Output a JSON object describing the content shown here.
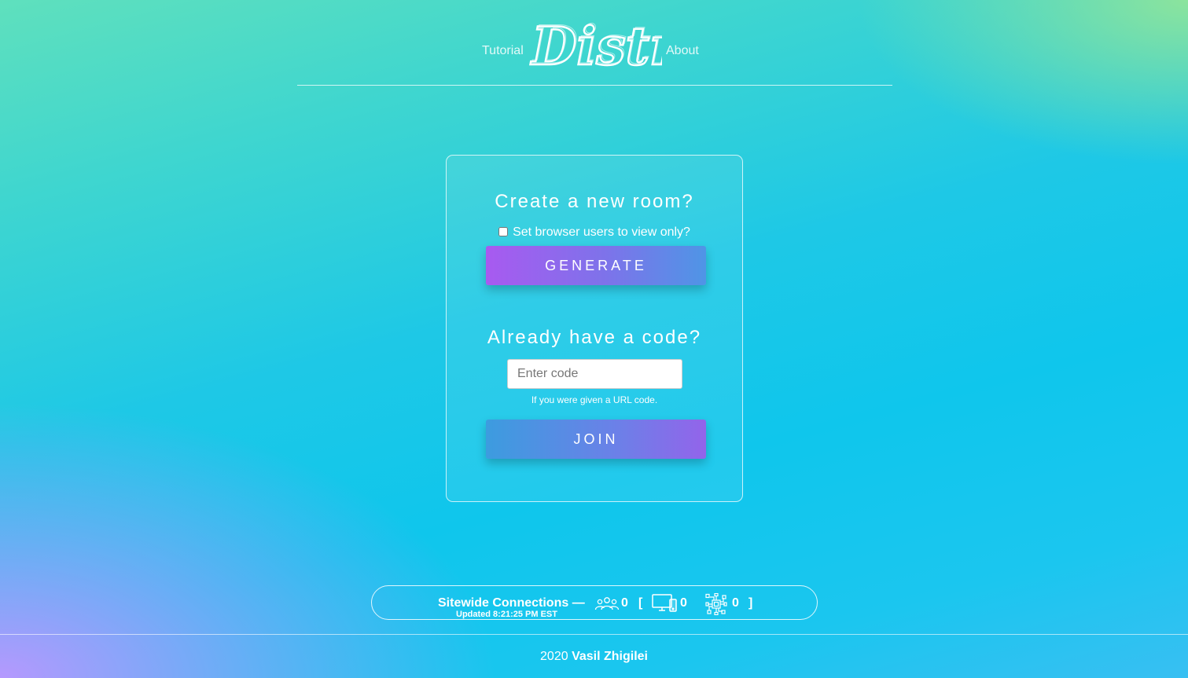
{
  "nav": {
    "tutorial": "Tutorial",
    "logo_text": "Distri",
    "about": "About"
  },
  "create": {
    "heading": "Create a new room?",
    "checkbox_label": "Set browser users to view only?",
    "checkbox_checked": false,
    "generate_label": "GENERATE"
  },
  "join": {
    "heading": "Already have a code?",
    "placeholder": "Enter code",
    "value": "",
    "hint": "If you were given a URL code.",
    "join_label": "JOIN"
  },
  "stats": {
    "title": "Sitewide Connections —",
    "updated": "Updated 8:21:25 PM EST",
    "users": "0",
    "bracket_open": "[",
    "devices": "0",
    "networks": "0",
    "bracket_close": "]",
    "icons": [
      "users-icon",
      "devices-icon",
      "network-icon"
    ]
  },
  "footer": {
    "year": "2020",
    "author": "Vasil Zhigilei"
  },
  "colors": {
    "generate_gradient": [
      "#a85af0",
      "#4f95e6"
    ],
    "join_gradient": [
      "#3c9cdf",
      "#9364ea"
    ],
    "background_main": "#0fc6ec"
  }
}
